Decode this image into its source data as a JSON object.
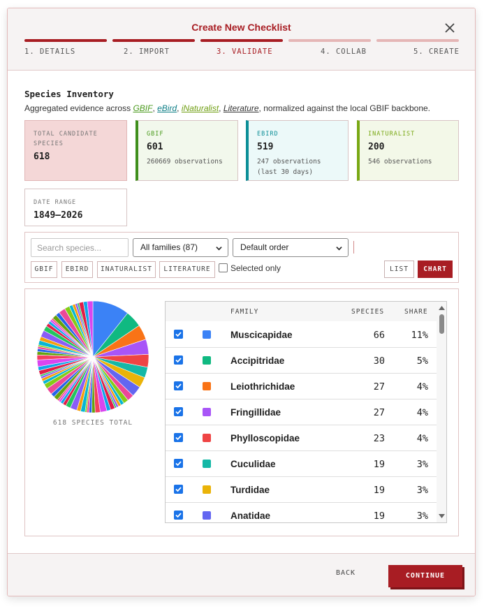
{
  "dialog": {
    "title": "Create New Checklist",
    "close_icon": "close-icon",
    "steps": [
      {
        "label": "1. DETAILS",
        "state": "done"
      },
      {
        "label": "2. IMPORT",
        "state": "done"
      },
      {
        "label": "3. VALIDATE",
        "state": "active"
      },
      {
        "label": "4. COLLAB",
        "state": "todo"
      },
      {
        "label": "5. CREATE",
        "state": "todo"
      }
    ]
  },
  "inventory": {
    "title": "Species Inventory",
    "desc_prefix": "Aggregated evidence across ",
    "src_gbif": "GBIF",
    "src_ebird": "eBird",
    "src_inat": "iNaturalist",
    "src_lit": "Literature",
    "sep": ", ",
    "desc_suffix": ", normalized against the local GBIF backbone."
  },
  "cards": {
    "total": {
      "label": "TOTAL CANDIDATE SPECIES",
      "value": "618"
    },
    "gbif": {
      "label": "GBIF",
      "value": "601",
      "note": "260669 observations"
    },
    "ebird": {
      "label": "EBIRD",
      "value": "519",
      "note": "247 observations (last 30 days)"
    },
    "inat": {
      "label": "INATURALIST",
      "value": "200",
      "note": "546 observations"
    },
    "date": {
      "label": "DATE RANGE",
      "value": "1849–2026"
    }
  },
  "filters": {
    "search_placeholder": "Search species...",
    "family_select": "All families (87)",
    "order_select": "Default order",
    "tags": [
      "GBIF",
      "EBIRD",
      "INATURALIST",
      "LITERATURE"
    ],
    "selected_only": "Selected only",
    "view_list": "LIST",
    "view_chart": "CHART"
  },
  "chart_data": {
    "type": "pie",
    "total_label": "618 SPECIES TOTAL",
    "total": 618,
    "slices": [
      {
        "name": "Muscicapidae",
        "value": 66,
        "color": "#3b82f6"
      },
      {
        "name": "Accipitridae",
        "value": 30,
        "color": "#10b981"
      },
      {
        "name": "Leiothrichidae",
        "value": 27,
        "color": "#f97316"
      },
      {
        "name": "Fringillidae",
        "value": 27,
        "color": "#a855f7"
      },
      {
        "name": "Phylloscopidae",
        "value": 23,
        "color": "#ef4444"
      },
      {
        "name": "Cuculidae",
        "value": 19,
        "color": "#14b8a6"
      },
      {
        "name": "Turdidae",
        "value": 19,
        "color": "#eab308"
      },
      {
        "name": "Anatidae",
        "value": 19,
        "color": "#6366f1"
      }
    ],
    "other_value": 388,
    "other_palette": [
      "#ec4899",
      "#84cc16",
      "#06b6d4",
      "#f59e0b",
      "#8b5cf6",
      "#22c55e",
      "#e11d48",
      "#0ea5e9",
      "#d946ef",
      "#f43f5e",
      "#65a30d",
      "#2563eb"
    ]
  },
  "table": {
    "headers": {
      "family": "FAMILY",
      "species": "SPECIES",
      "share": "SHARE"
    },
    "rows": [
      {
        "family": "Muscicapidae",
        "species": "66",
        "share": "11%",
        "color": "#3b82f6"
      },
      {
        "family": "Accipitridae",
        "species": "30",
        "share": "5%",
        "color": "#10b981"
      },
      {
        "family": "Leiothrichidae",
        "species": "27",
        "share": "4%",
        "color": "#f97316"
      },
      {
        "family": "Fringillidae",
        "species": "27",
        "share": "4%",
        "color": "#a855f7"
      },
      {
        "family": "Phylloscopidae",
        "species": "23",
        "share": "4%",
        "color": "#ef4444"
      },
      {
        "family": "Cuculidae",
        "species": "19",
        "share": "3%",
        "color": "#14b8a6"
      },
      {
        "family": "Turdidae",
        "species": "19",
        "share": "3%",
        "color": "#eab308"
      },
      {
        "family": "Anatidae",
        "species": "19",
        "share": "3%",
        "color": "#6366f1"
      }
    ]
  },
  "footer": {
    "back": "BACK",
    "continue": "CONTINUE"
  },
  "colors": {
    "accent": "#a81d23",
    "checkbox": "#1a73e8"
  }
}
